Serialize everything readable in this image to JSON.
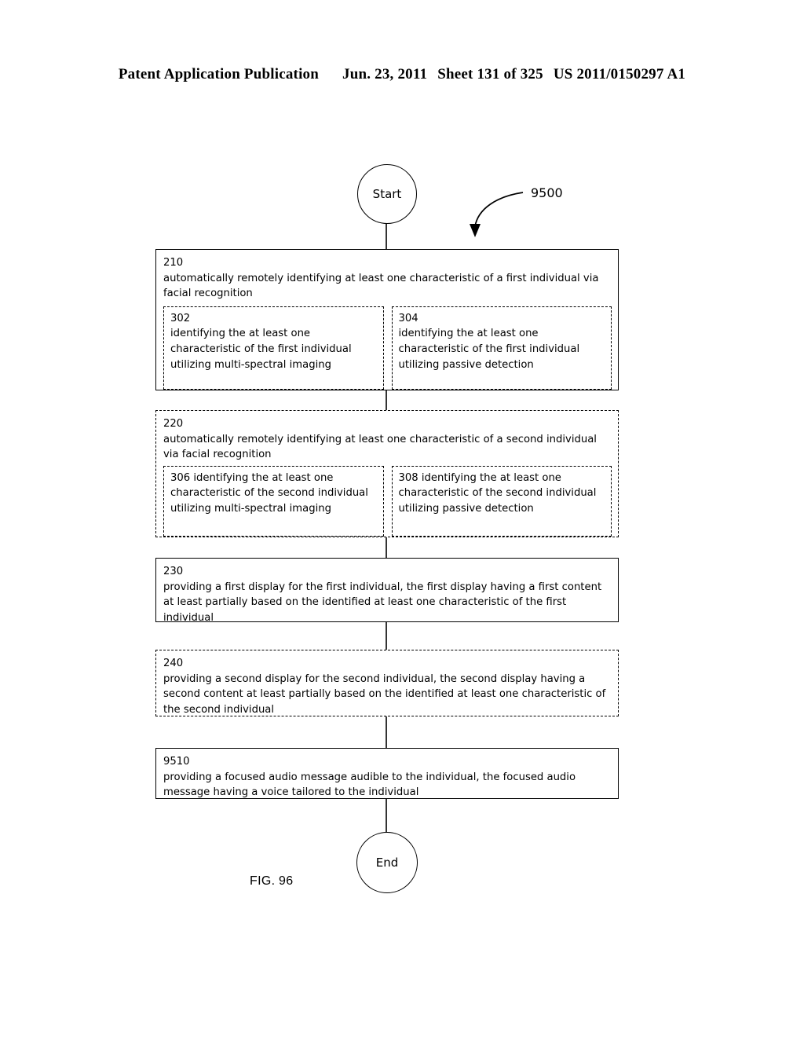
{
  "header": {
    "publication": "Patent Application Publication",
    "date": "Jun. 23, 2011",
    "sheet": "Sheet 131 of 325",
    "patent_number": "US 2011/0150297 A1"
  },
  "figure": {
    "label": "FIG. 96",
    "diagram_ref": "9500"
  },
  "nodes": {
    "start": "Start",
    "end": "End"
  },
  "steps": [
    {
      "id": "210",
      "number": "210",
      "text": "automatically remotely identifying at least one characteristic of a first individual via facial recognition",
      "border": "solid",
      "substeps": [
        {
          "number": "302",
          "text": "identifying the at least one characteristic of the first individual utilizing multi-spectral imaging",
          "number_inline": false
        },
        {
          "number": "304",
          "text": "identifying the at least one characteristic of the first individual utilizing passive detection",
          "number_inline": false
        }
      ]
    },
    {
      "id": "220",
      "number": "220",
      "text": "automatically remotely identifying at least one characteristic of a second individual via facial recognition",
      "border": "dashed",
      "substeps": [
        {
          "number": "306",
          "text": "identifying the at least one characteristic of the second individual utilizing multi-spectral imaging",
          "number_inline": true
        },
        {
          "number": "308",
          "text": "identifying the at least one characteristic of the second individual utilizing passive detection",
          "number_inline": true
        }
      ]
    },
    {
      "id": "230",
      "number": "230",
      "text": "providing a first display for the first individual, the first display having a first content at least partially based on the identified at least one characteristic of the first individual",
      "border": "solid",
      "substeps": []
    },
    {
      "id": "240",
      "number": "240",
      "text": "providing a second display for the second individual, the second display having a second content at least partially based on the identified at least one characteristic of the second individual",
      "border": "dashed",
      "substeps": []
    },
    {
      "id": "9510",
      "number": "9510",
      "text": "providing a focused audio message audible to the individual, the focused audio message having a voice tailored to the individual",
      "border": "solid",
      "substeps": []
    }
  ]
}
